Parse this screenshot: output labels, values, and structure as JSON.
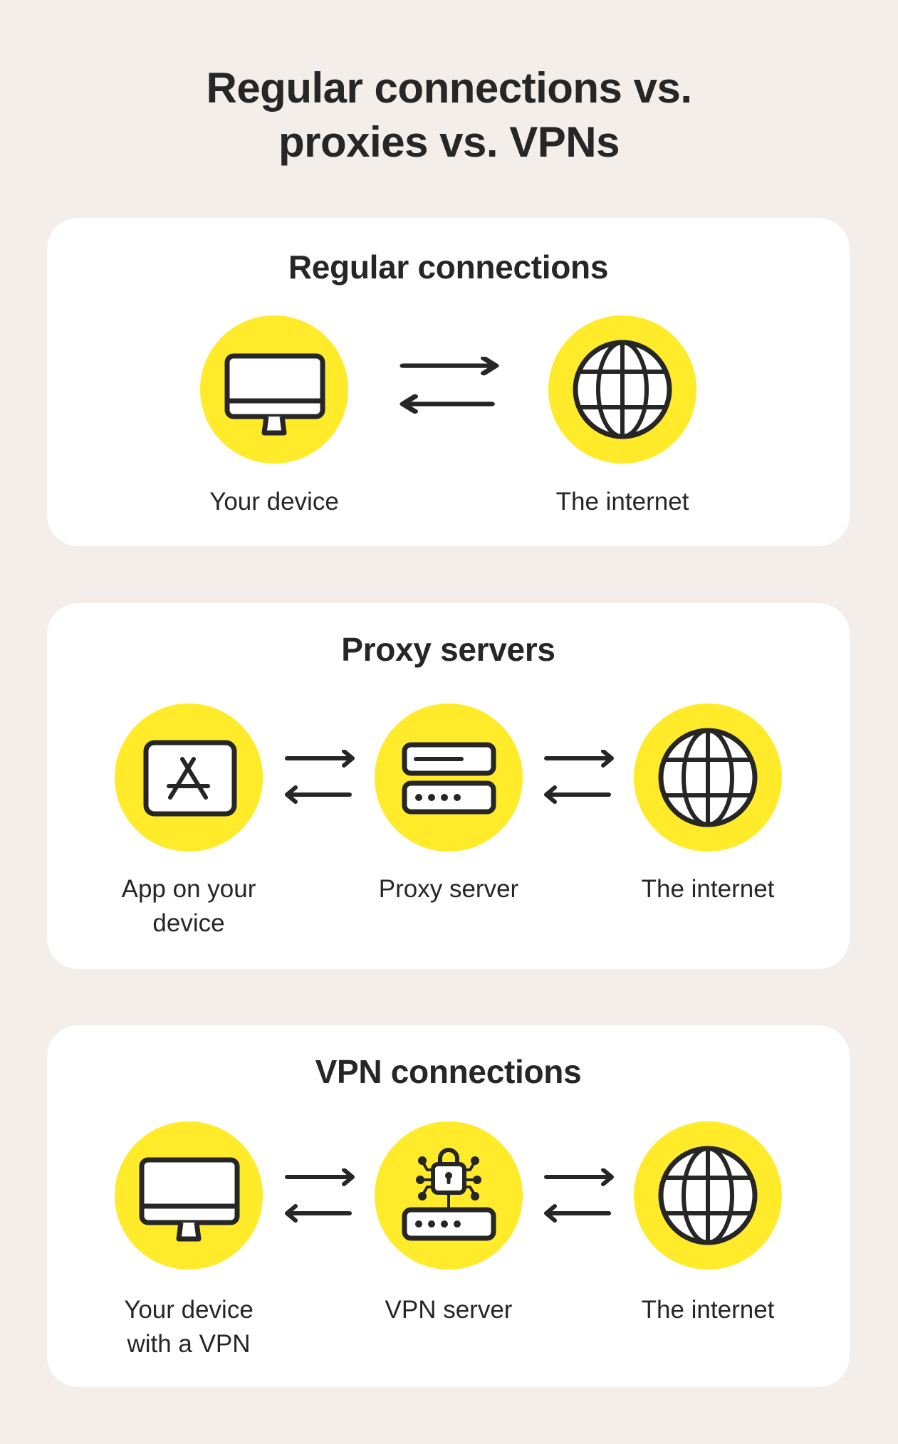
{
  "title": {
    "line1": "Regular connections vs.",
    "line2": "proxies vs. VPNs"
  },
  "colors": {
    "background": "#F3EEEA",
    "card": "#FFFFFF",
    "accent_yellow": "#FFEB2A",
    "ink": "#262626"
  },
  "sections": [
    {
      "title": "Regular connections",
      "nodes": [
        {
          "icon": "monitor-icon",
          "label_lines": [
            "Your device"
          ]
        },
        {
          "icon": "globe-icon",
          "label_lines": [
            "The internet"
          ]
        }
      ],
      "connectors": [
        "two-way-arrows"
      ]
    },
    {
      "title": "Proxy servers",
      "nodes": [
        {
          "icon": "app-store-icon",
          "label_lines": [
            "App on your",
            "device"
          ]
        },
        {
          "icon": "server-icon",
          "label_lines": [
            "Proxy server"
          ]
        },
        {
          "icon": "globe-icon",
          "label_lines": [
            "The internet"
          ]
        }
      ],
      "connectors": [
        "two-way-arrows",
        "two-way-arrows"
      ]
    },
    {
      "title": "VPN connections",
      "nodes": [
        {
          "icon": "monitor-icon",
          "label_lines": [
            "Your device",
            "with a VPN"
          ]
        },
        {
          "icon": "vpn-server-lock-icon",
          "label_lines": [
            "VPN server"
          ]
        },
        {
          "icon": "globe-icon",
          "label_lines": [
            "The internet"
          ]
        }
      ],
      "connectors": [
        "two-way-arrows",
        "two-way-arrows"
      ]
    }
  ]
}
